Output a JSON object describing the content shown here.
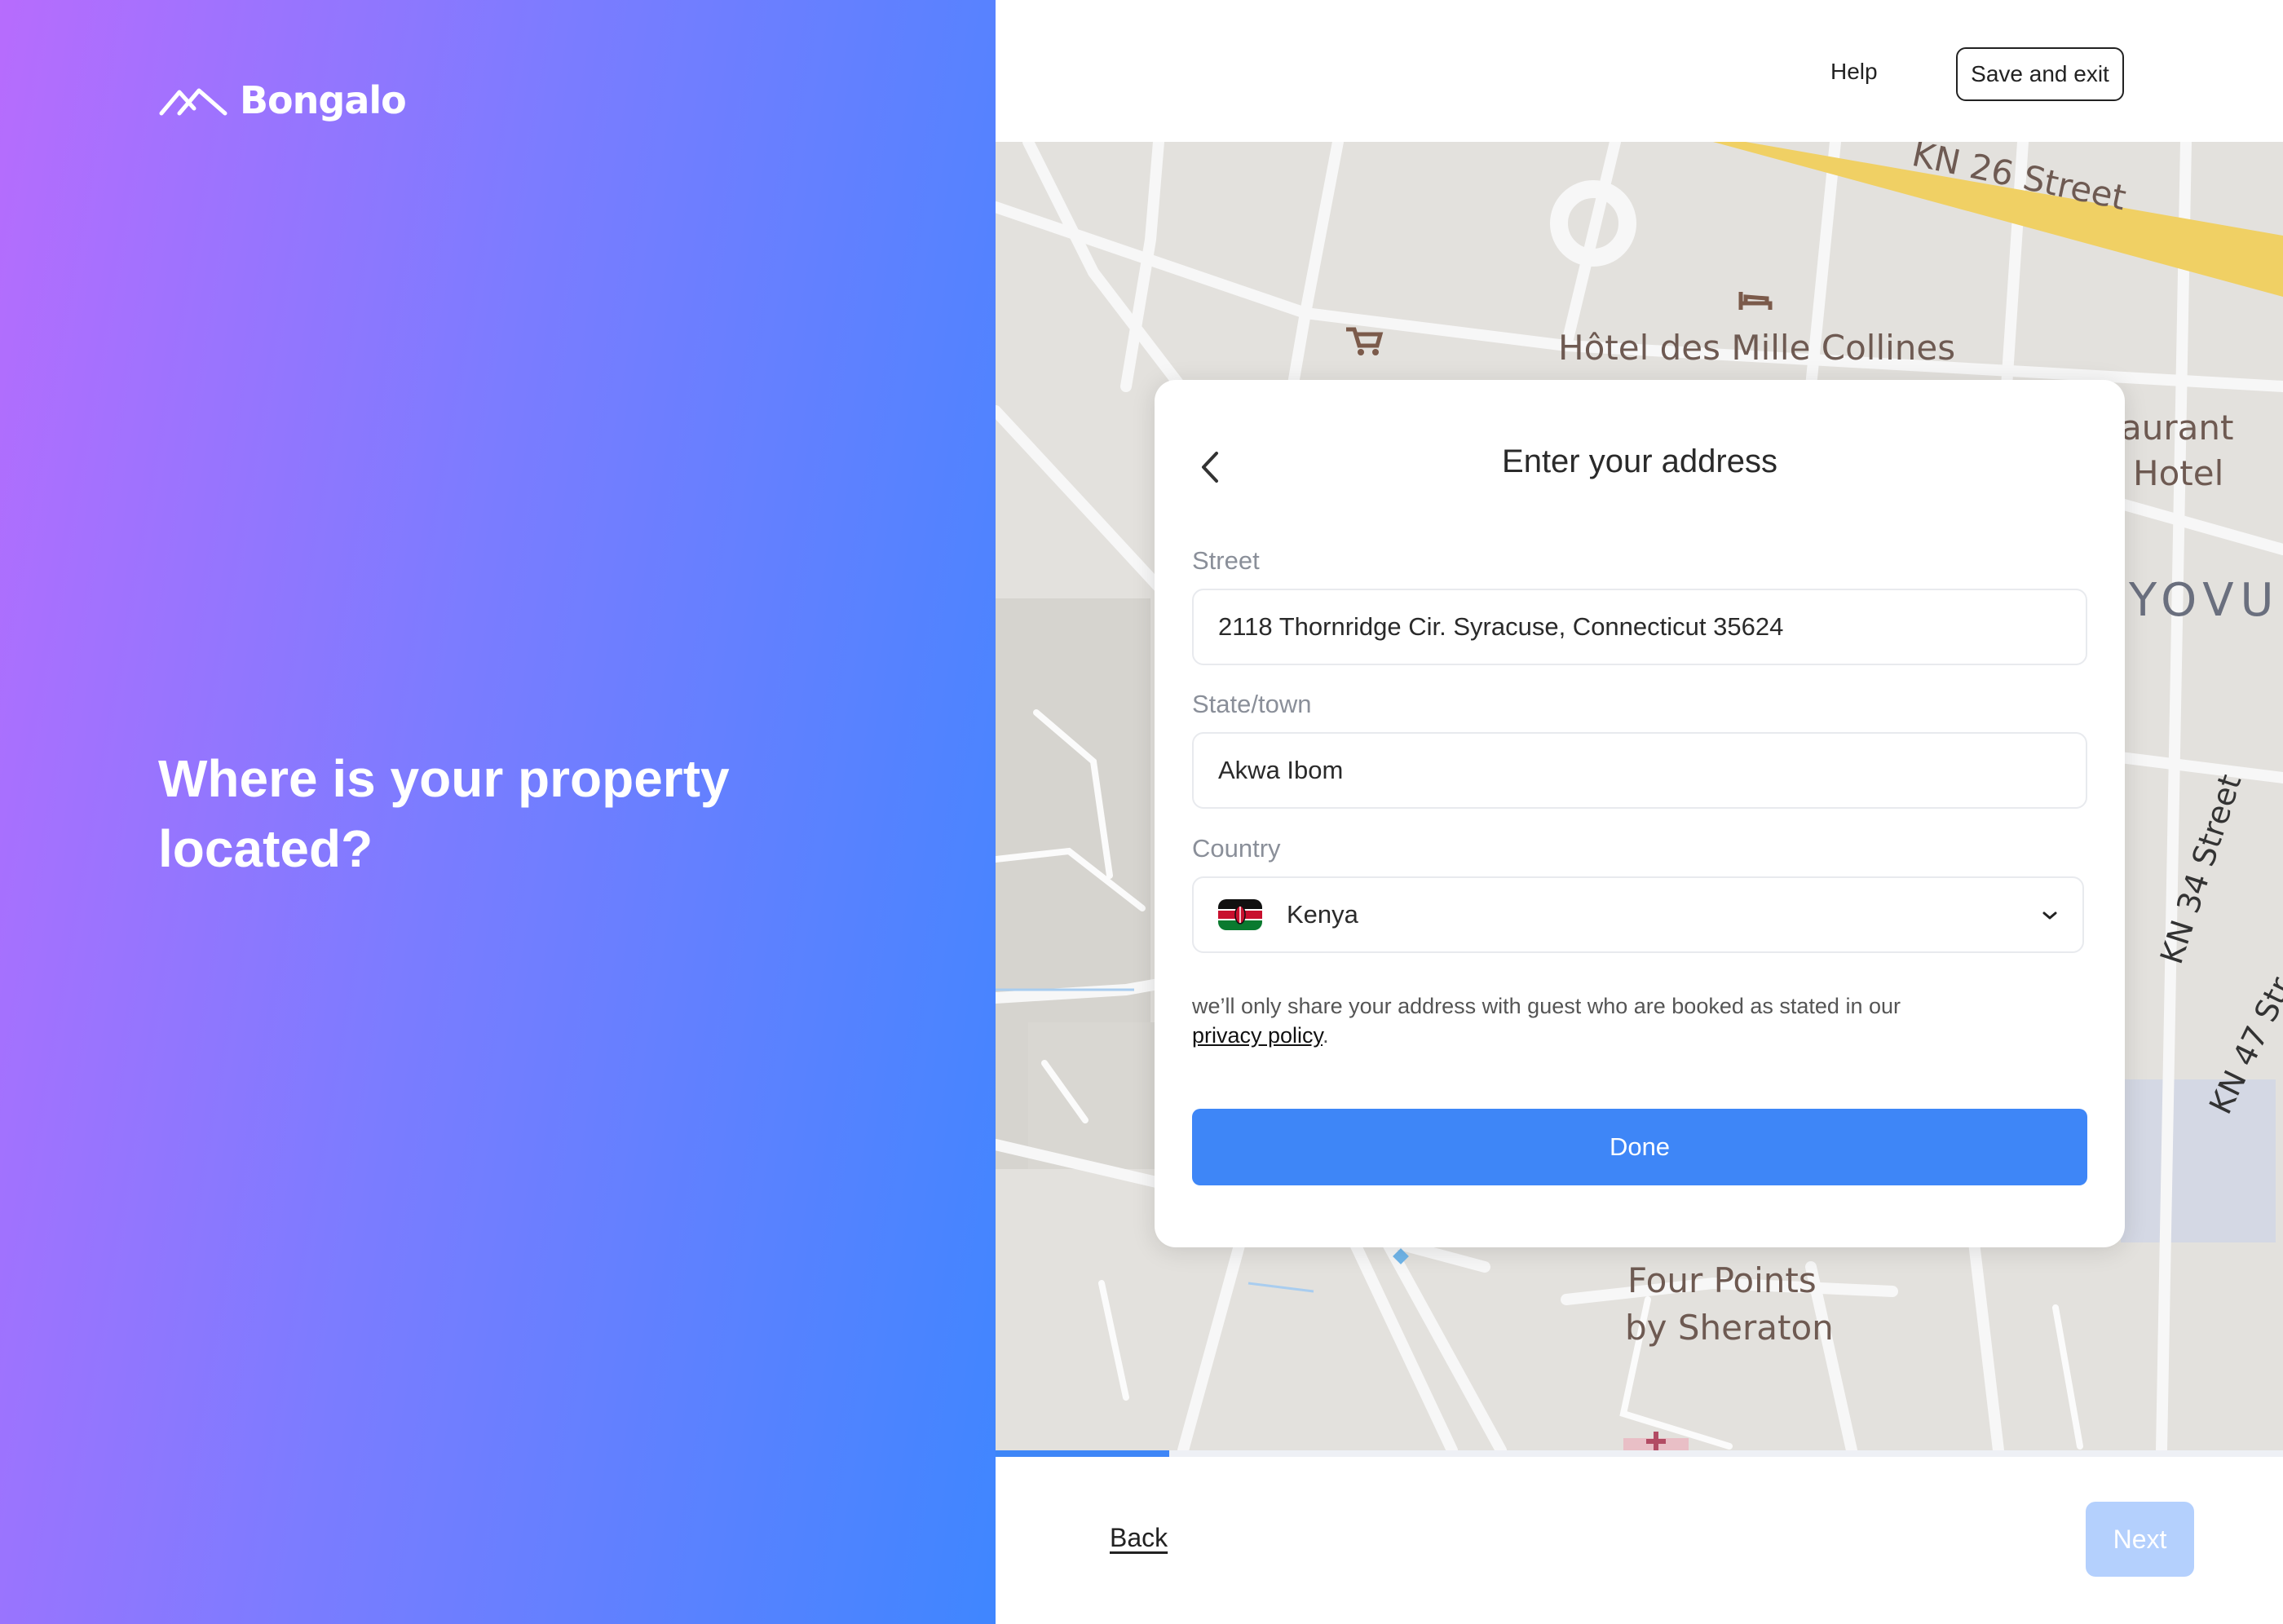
{
  "brand": {
    "name": "Bongalo"
  },
  "left_panel": {
    "headline": "Where is your property located?"
  },
  "header": {
    "help_label": "Help",
    "save_exit_label": "Save and exit"
  },
  "map": {
    "labels": {
      "street_top": "KN 26 Street",
      "hotel_des_mille_collines": "Hôtel des Mille Collines",
      "restaurant": "aurant",
      "hotel": "Hotel",
      "kiyovu": "YOVU",
      "kn34": "KN 34 Street",
      "kn47": "KN 47 Str",
      "four_points": "Four Points",
      "by_sheraton": "by Sheraton"
    },
    "icons": [
      "hotel-icon",
      "shopping-cart-icon",
      "hospital-icon"
    ]
  },
  "modal": {
    "title": "Enter your address",
    "street": {
      "label": "Street",
      "value": "2118 Thornridge Cir. Syracuse, Connecticut 35624"
    },
    "state": {
      "label": "State/town",
      "value": "Akwa Ibom"
    },
    "country": {
      "label": "Country",
      "value": "Kenya",
      "flag": "kenya-flag"
    },
    "note_text": "we’ll only share your address with guest who are booked as stated in our",
    "privacy_link": "privacy policy",
    "note_period": ".",
    "done_label": "Done"
  },
  "footer": {
    "back_label": "Back",
    "next_label": "Next",
    "progress_fraction": 0.135
  },
  "colors": {
    "primary": "#3E86F7",
    "next_disabled": "#B4D0FD",
    "gradient_start": "#B76CFD",
    "gradient_end": "#3F86FF"
  }
}
